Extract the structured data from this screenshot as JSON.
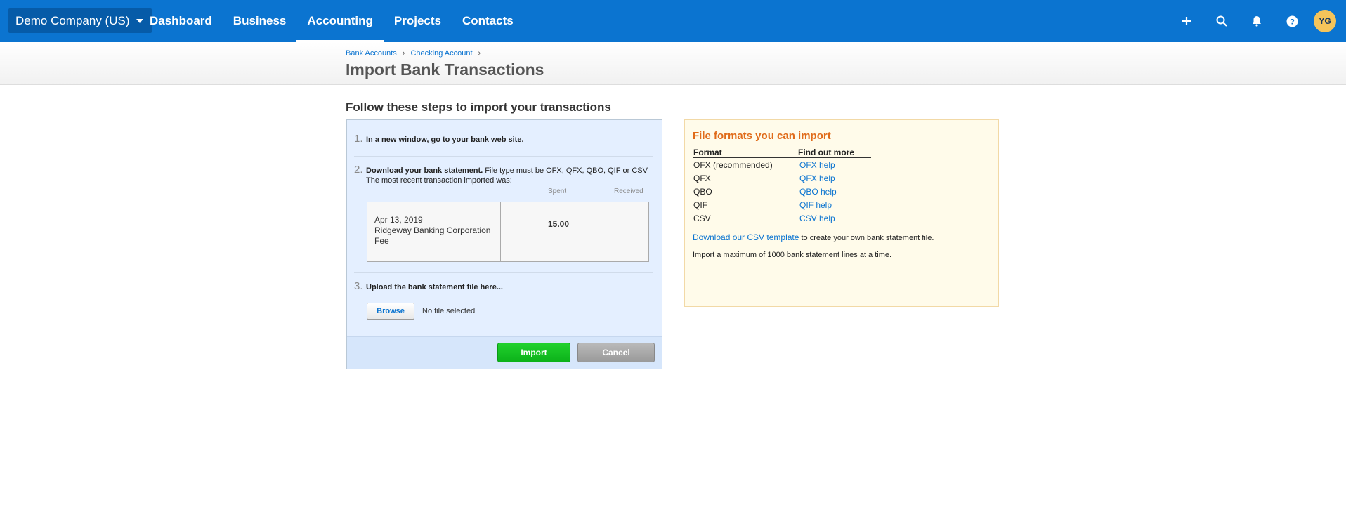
{
  "topbar": {
    "org_name": "Demo Company (US)",
    "nav": [
      "Dashboard",
      "Business",
      "Accounting",
      "Projects",
      "Contacts"
    ],
    "active_nav": "Accounting",
    "avatar_initials": "YG"
  },
  "breadcrumb": [
    "Bank Accounts",
    "Checking Account"
  ],
  "page_title": "Import Bank Transactions",
  "steps": {
    "heading": "Follow these steps to import your transactions",
    "step1": {
      "num": "1.",
      "text": "In a new window, go to your bank web site."
    },
    "step2": {
      "num": "2.",
      "bold": "Download your bank statement.",
      "text": " File type must be OFX, QFX, QBO, QIF or CSV",
      "subtext": "The most recent transaction imported was:",
      "col_spent": "Spent",
      "col_received": "Received",
      "txn_date": "Apr 13, 2019",
      "txn_desc": "Ridgeway Banking Corporation Fee",
      "txn_spent": "15.00",
      "txn_received": ""
    },
    "step3": {
      "num": "3.",
      "text": "Upload the bank statement file here...",
      "browse_label": "Browse",
      "file_status": "No file selected"
    },
    "import_label": "Import",
    "cancel_label": "Cancel"
  },
  "formats": {
    "title": "File formats you can import",
    "col_format": "Format",
    "col_more": "Find out more",
    "rows": [
      {
        "format": "OFX (recommended)",
        "help": "OFX help"
      },
      {
        "format": "QFX",
        "help": "QFX help"
      },
      {
        "format": "QBO",
        "help": "QBO help"
      },
      {
        "format": "QIF",
        "help": "QIF help"
      },
      {
        "format": "CSV",
        "help": "CSV help"
      }
    ],
    "csv_link": "Download our CSV template",
    "csv_suffix": " to create your own bank statement file.",
    "limit_note": "Import a maximum of 1000 bank statement lines at a time."
  },
  "colors": {
    "brand": "#0b74d0",
    "import_green": "#13c321",
    "accent_orange": "#e06b1a"
  }
}
